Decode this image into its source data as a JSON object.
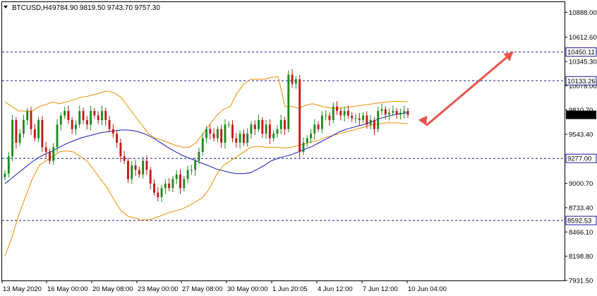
{
  "header": {
    "symbol": "BTCUSD,H4",
    "ohlc": "9784.90 9819.50 9743.70 9757.30"
  },
  "colors": {
    "background": "#ffffff",
    "bull_candle": "#1f8a1f",
    "bear_candle": "#c01a1a",
    "bollinger": "#f08c00",
    "moving_average": "#1a1ab8",
    "level_line": "#1a1a9a",
    "arrow": "#e8554a",
    "price_tag": "#1a1a9a"
  },
  "chart_data": {
    "type": "candlestick",
    "ylim": [
      7931.5,
      11000
    ],
    "y_ticks": [
      "10888.00",
      "10612.60",
      "10345.30",
      "10078.00",
      "9810.70",
      "9543.40",
      "9000.70",
      "8733.40",
      "8466.10",
      "8198.80",
      "7931.50"
    ],
    "x_ticks": [
      "13 May 2020",
      "16 May 00:00",
      "20 May 08:00",
      "23 May 00:00",
      "27 May 08:00",
      "30 May 00:00",
      "1 Jun 20:05",
      "4 Jun 12:00",
      "7 Jun 12:00",
      "10 Jun 04:00"
    ],
    "levels": [
      {
        "value": 10450.11,
        "label": "10450.11"
      },
      {
        "value": 10133.26,
        "label": "10133.26"
      },
      {
        "value": 9277.0,
        "label": "9277.00"
      },
      {
        "value": 8592.53,
        "label": "8592.53"
      }
    ],
    "current_price": "9757.30",
    "close": [
      9110,
      9300,
      9700,
      9450,
      9550,
      9700,
      9800,
      9600,
      9500,
      9700,
      9400,
      9350,
      9250,
      9400,
      9650,
      9750,
      9800,
      9700,
      9600,
      9650,
      9800,
      9700,
      9650,
      9800,
      9750,
      9700,
      9800,
      9700,
      9600,
      9550,
      9450,
      9300,
      9250,
      9050,
      9200,
      9150,
      9100,
      9250,
      9150,
      9000,
      8900,
      8850,
      8950,
      9000,
      8950,
      9050,
      9100,
      8950,
      9050,
      9150,
      9150,
      9250,
      9350,
      9500,
      9600,
      9550,
      9500,
      9600,
      9450,
      9650,
      9650,
      9500,
      9450,
      9550,
      9450,
      9550,
      9650,
      9600,
      9700,
      9550,
      9650,
      9500,
      9550,
      9600,
      9700,
      9600,
      10200,
      10100,
      10150,
      9350,
      9450,
      9500,
      9550,
      9650,
      9600,
      9750,
      9750,
      9700,
      9850,
      9800,
      9750,
      9800,
      9750,
      9720,
      9720,
      9700,
      9750,
      9650,
      9700,
      9600,
      9800,
      9820,
      9760,
      9780,
      9800,
      9760,
      9780,
      9800,
      9757
    ],
    "ma": [
      9000,
      9060,
      9120,
      9180,
      9240,
      9290,
      9330,
      9360,
      9400,
      9440,
      9470,
      9500,
      9520,
      9540,
      9560,
      9570,
      9580,
      9590,
      9590,
      9580,
      9560,
      9530,
      9490,
      9440,
      9390,
      9350,
      9310,
      9280,
      9250,
      9220,
      9190,
      9160,
      9140,
      9120,
      9110,
      9110,
      9120,
      9160,
      9200,
      9250,
      9280,
      9300,
      9320,
      9350,
      9380,
      9410,
      9450,
      9490,
      9530,
      9570,
      9600,
      9620,
      9640,
      9660,
      9690,
      9720,
      9740,
      9760,
      9770,
      9780
    ],
    "upper_band": [
      9900,
      9850,
      9800,
      9800,
      9800,
      9850,
      9870,
      9900,
      9880,
      9900,
      9920,
      9950,
      9960,
      9980,
      10000,
      10020,
      10000,
      9950,
      9850,
      9750,
      9650,
      9550,
      9500,
      9480,
      9450,
      9420,
      9400,
      9400,
      9450,
      9550,
      9650,
      9750,
      9820,
      9850,
      10000,
      10100,
      10150,
      10150,
      10150,
      10170,
      10180,
      9850,
      9850,
      9830,
      9860,
      9880,
      9860,
      9840,
      9830,
      9830,
      9840,
      9850,
      9860,
      9870,
      9880,
      9890,
      9900,
      9905,
      9905,
      9900
    ],
    "lower_band": [
      8200,
      8400,
      8650,
      8850,
      9050,
      9200,
      9250,
      9300,
      9350,
      9360,
      9350,
      9300,
      9250,
      9150,
      9050,
      8950,
      8820,
      8700,
      8640,
      8620,
      8600,
      8600,
      8620,
      8650,
      8680,
      8700,
      8720,
      8760,
      8800,
      8850,
      8950,
      9100,
      9200,
      9250,
      9300,
      9350,
      9400,
      9410,
      9400,
      9400,
      9400,
      9390,
      9400,
      9420,
      9440,
      9460,
      9480,
      9510,
      9530,
      9550,
      9570,
      9590,
      9610,
      9630,
      9650,
      9660,
      9670,
      9670,
      9665,
      9660
    ]
  }
}
